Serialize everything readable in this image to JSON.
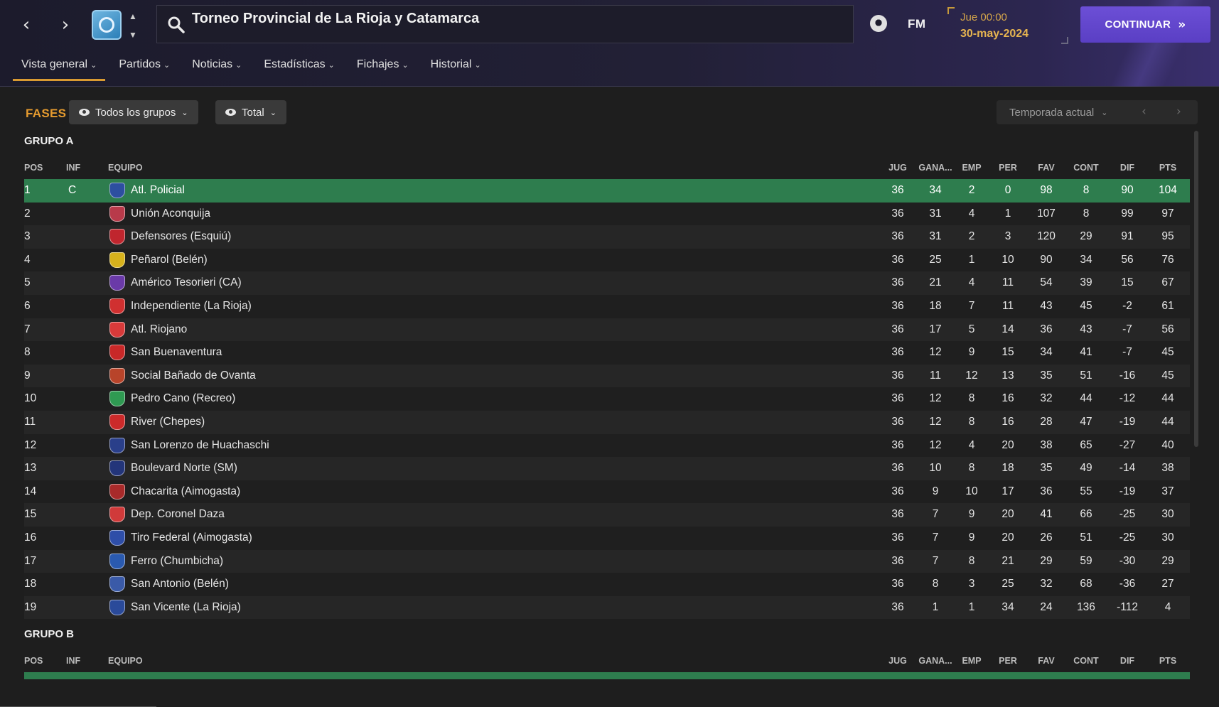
{
  "header": {
    "back_icon": "chevron-left-icon",
    "forward_icon": "chevron-right-icon",
    "competition_title": "Torneo Provincial de La Rioja y Catamarca",
    "brand": "FM",
    "date_day_time": "Jue 00:00",
    "date": "30-may-2024",
    "continue_label": "CONTINUAR"
  },
  "tabs": [
    {
      "label": "Vista general",
      "active": true
    },
    {
      "label": "Partidos"
    },
    {
      "label": "Noticias"
    },
    {
      "label": "Estadísticas"
    },
    {
      "label": "Fichajes"
    },
    {
      "label": "Historial"
    }
  ],
  "filters": {
    "section_label": "FASES",
    "group_filter": "Todos los grupos",
    "scope_filter": "Total",
    "season": "Temporada actual"
  },
  "columns": [
    "POS",
    "INF",
    "EQUIPO",
    "JUG",
    "GANA...",
    "EMP",
    "PER",
    "FAV",
    "CONT",
    "DIF",
    "PTS"
  ],
  "colors": {
    "accent": "#d99a32",
    "continue": "#5f44cc",
    "promotion_row": "#2e7d4e"
  },
  "group_a": {
    "title": "GRUPO A",
    "rows": [
      {
        "pos": "1",
        "inf": "C",
        "team": "Atl. Policial",
        "jug": "36",
        "gan": "34",
        "emp": "2",
        "per": "0",
        "fav": "98",
        "cont": "8",
        "dif": "90",
        "pts": "104",
        "crest": "#2d4fa0"
      },
      {
        "pos": "2",
        "inf": "",
        "team": "Unión Aconquija",
        "jug": "36",
        "gan": "31",
        "emp": "4",
        "per": "1",
        "fav": "107",
        "cont": "8",
        "dif": "99",
        "pts": "97",
        "crest": "#b83a4a"
      },
      {
        "pos": "3",
        "inf": "",
        "team": "Defensores (Esquiú)",
        "jug": "36",
        "gan": "31",
        "emp": "2",
        "per": "3",
        "fav": "120",
        "cont": "29",
        "dif": "91",
        "pts": "95",
        "crest": "#c0262e"
      },
      {
        "pos": "4",
        "inf": "",
        "team": "Peñarol (Belén)",
        "jug": "36",
        "gan": "25",
        "emp": "1",
        "per": "10",
        "fav": "90",
        "cont": "34",
        "dif": "56",
        "pts": "76",
        "crest": "#d7b21c"
      },
      {
        "pos": "5",
        "inf": "",
        "team": "Américo Tesorieri (CA)",
        "jug": "36",
        "gan": "21",
        "emp": "4",
        "per": "11",
        "fav": "54",
        "cont": "39",
        "dif": "15",
        "pts": "67",
        "crest": "#6a3aa8"
      },
      {
        "pos": "6",
        "inf": "",
        "team": "Independiente (La Rioja)",
        "jug": "36",
        "gan": "18",
        "emp": "7",
        "per": "11",
        "fav": "43",
        "cont": "45",
        "dif": "-2",
        "pts": "61",
        "crest": "#d03030"
      },
      {
        "pos": "7",
        "inf": "",
        "team": "Atl. Riojano",
        "jug": "36",
        "gan": "17",
        "emp": "5",
        "per": "14",
        "fav": "36",
        "cont": "43",
        "dif": "-7",
        "pts": "56",
        "crest": "#d83a3a"
      },
      {
        "pos": "8",
        "inf": "",
        "team": "San Buenaventura",
        "jug": "36",
        "gan": "12",
        "emp": "9",
        "per": "15",
        "fav": "34",
        "cont": "41",
        "dif": "-7",
        "pts": "45",
        "crest": "#c82828"
      },
      {
        "pos": "9",
        "inf": "",
        "team": "Social Bañado de Ovanta",
        "jug": "36",
        "gan": "11",
        "emp": "12",
        "per": "13",
        "fav": "35",
        "cont": "51",
        "dif": "-16",
        "pts": "45",
        "crest": "#b8442a"
      },
      {
        "pos": "10",
        "inf": "",
        "team": "Pedro Cano (Recreo)",
        "jug": "36",
        "gan": "12",
        "emp": "8",
        "per": "16",
        "fav": "32",
        "cont": "44",
        "dif": "-12",
        "pts": "44",
        "crest": "#2f9a52"
      },
      {
        "pos": "11",
        "inf": "",
        "team": "River (Chepes)",
        "jug": "36",
        "gan": "12",
        "emp": "8",
        "per": "16",
        "fav": "28",
        "cont": "47",
        "dif": "-19",
        "pts": "44",
        "crest": "#cc2a2a"
      },
      {
        "pos": "12",
        "inf": "",
        "team": "San Lorenzo de Huachaschi",
        "jug": "36",
        "gan": "12",
        "emp": "4",
        "per": "20",
        "fav": "38",
        "cont": "65",
        "dif": "-27",
        "pts": "40",
        "crest": "#2a3f8a"
      },
      {
        "pos": "13",
        "inf": "",
        "team": "Boulevard Norte (SM)",
        "jug": "36",
        "gan": "10",
        "emp": "8",
        "per": "18",
        "fav": "35",
        "cont": "49",
        "dif": "-14",
        "pts": "38",
        "crest": "#23357a"
      },
      {
        "pos": "14",
        "inf": "",
        "team": "Chacarita (Aimogasta)",
        "jug": "36",
        "gan": "9",
        "emp": "10",
        "per": "17",
        "fav": "36",
        "cont": "55",
        "dif": "-19",
        "pts": "37",
        "crest": "#a82a2a"
      },
      {
        "pos": "15",
        "inf": "",
        "team": "Dep. Coronel Daza",
        "jug": "36",
        "gan": "7",
        "emp": "9",
        "per": "20",
        "fav": "41",
        "cont": "66",
        "dif": "-25",
        "pts": "30",
        "crest": "#d03a3a"
      },
      {
        "pos": "16",
        "inf": "",
        "team": "Tiro Federal (Aimogasta)",
        "jug": "36",
        "gan": "7",
        "emp": "9",
        "per": "20",
        "fav": "26",
        "cont": "51",
        "dif": "-25",
        "pts": "30",
        "crest": "#2e4ea8"
      },
      {
        "pos": "17",
        "inf": "",
        "team": "Ferro (Chumbicha)",
        "jug": "36",
        "gan": "7",
        "emp": "8",
        "per": "21",
        "fav": "29",
        "cont": "59",
        "dif": "-30",
        "pts": "29",
        "crest": "#2a5ab0"
      },
      {
        "pos": "18",
        "inf": "",
        "team": "San Antonio (Belén)",
        "jug": "36",
        "gan": "8",
        "emp": "3",
        "per": "25",
        "fav": "32",
        "cont": "68",
        "dif": "-36",
        "pts": "27",
        "crest": "#3a5aa8"
      },
      {
        "pos": "19",
        "inf": "",
        "team": "San Vicente (La Rioja)",
        "jug": "36",
        "gan": "1",
        "emp": "1",
        "per": "34",
        "fav": "24",
        "cont": "136",
        "dif": "-112",
        "pts": "4",
        "crest": "#2a4a9a"
      }
    ]
  },
  "group_b": {
    "title": "GRUPO B"
  }
}
